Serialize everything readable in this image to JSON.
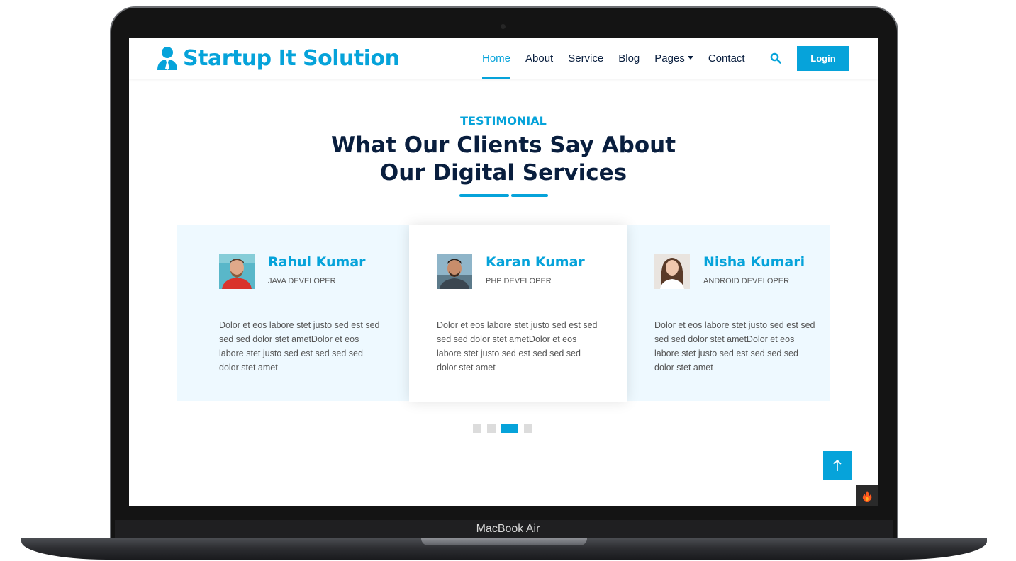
{
  "device": {
    "model_label": "MacBook Air"
  },
  "brand": {
    "name": "Startup It Solution",
    "icon": "user-tie-icon",
    "color": "#06A3DA"
  },
  "nav": {
    "items": [
      {
        "label": "Home",
        "active": true
      },
      {
        "label": "About",
        "active": false
      },
      {
        "label": "Service",
        "active": false
      },
      {
        "label": "Blog",
        "active": false
      },
      {
        "label": "Pages",
        "active": false,
        "has_dropdown": true
      },
      {
        "label": "Contact",
        "active": false
      }
    ],
    "search_icon": "search-icon",
    "login_label": "Login"
  },
  "section": {
    "eyebrow": "TESTIMONIAL",
    "heading_line1": "What Our Clients Say About",
    "heading_line2": "Our Digital Services"
  },
  "testimonials": [
    {
      "name": "Rahul Kumar",
      "role": "JAVA DEVELOPER",
      "text": "Dolor et eos labore stet justo sed est sed sed sed dolor stet ametDolor et eos labore stet justo sed est sed sed sed dolor stet amet"
    },
    {
      "name": "Karan Kumar",
      "role": "PHP DEVELOPER",
      "text": "Dolor et eos labore stet justo sed est sed sed sed dolor stet ametDolor et eos labore stet justo sed est sed sed sed dolor stet amet"
    },
    {
      "name": "Nisha Kumari",
      "role": "ANDROID DEVELOPER",
      "text": "Dolor et eos labore stet justo sed est sed sed sed dolor stet ametDolor et eos labore stet justo sed est sed sed sed dolor stet amet"
    }
  ],
  "carousel": {
    "dot_count": 4,
    "active_dot": 3
  },
  "colors": {
    "primary": "#06A3DA",
    "dark": "#091E3E",
    "light_bg": "#EEF9FF"
  }
}
